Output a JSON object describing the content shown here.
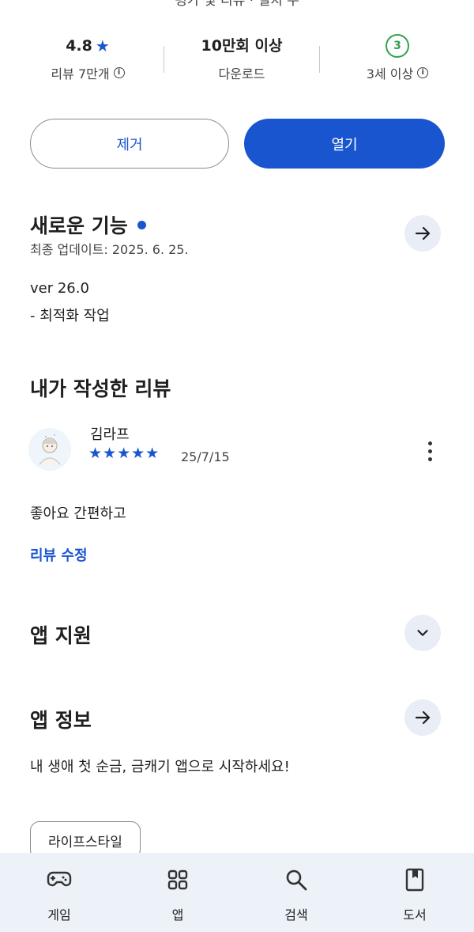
{
  "header_partial": "평가 및 리뷰 · 설치 수",
  "stats": {
    "rating": {
      "value": "4.8",
      "label": "리뷰 7만개"
    },
    "downloads": {
      "value": "10만회 이상",
      "label": "다운로드"
    },
    "age": {
      "badge": "3",
      "label": "3세 이상"
    }
  },
  "actions": {
    "remove_label": "제거",
    "open_label": "열기"
  },
  "whats_new": {
    "title": "새로운 기능",
    "updated": "최종 업데이트: 2025. 6. 25.",
    "lines": [
      "ver 26.0",
      "- 최적화 작업"
    ]
  },
  "my_review": {
    "title": "내가 작성한 리뷰",
    "reviewer": "김라프",
    "stars": "★★★★★",
    "rating": 5,
    "date": "25/7/15",
    "text": "좋아요 간편하고",
    "edit_label": "리뷰 수정"
  },
  "app_support": {
    "title": "앱 지원"
  },
  "app_info": {
    "title": "앱 정보",
    "description": "내 생애 첫 순금, 금캐기 앱으로 시작하세요!",
    "category": "라이프스타일"
  },
  "bottom_nav": [
    {
      "label": "게임",
      "icon": "gamepad-icon"
    },
    {
      "label": "앱",
      "icon": "apps-grid-icon"
    },
    {
      "label": "검색",
      "icon": "search-icon"
    },
    {
      "label": "도서",
      "icon": "book-icon"
    }
  ],
  "colors": {
    "accent": "#1a55d0",
    "age_green": "#33a04e",
    "nav_bg": "#edf2f9"
  }
}
